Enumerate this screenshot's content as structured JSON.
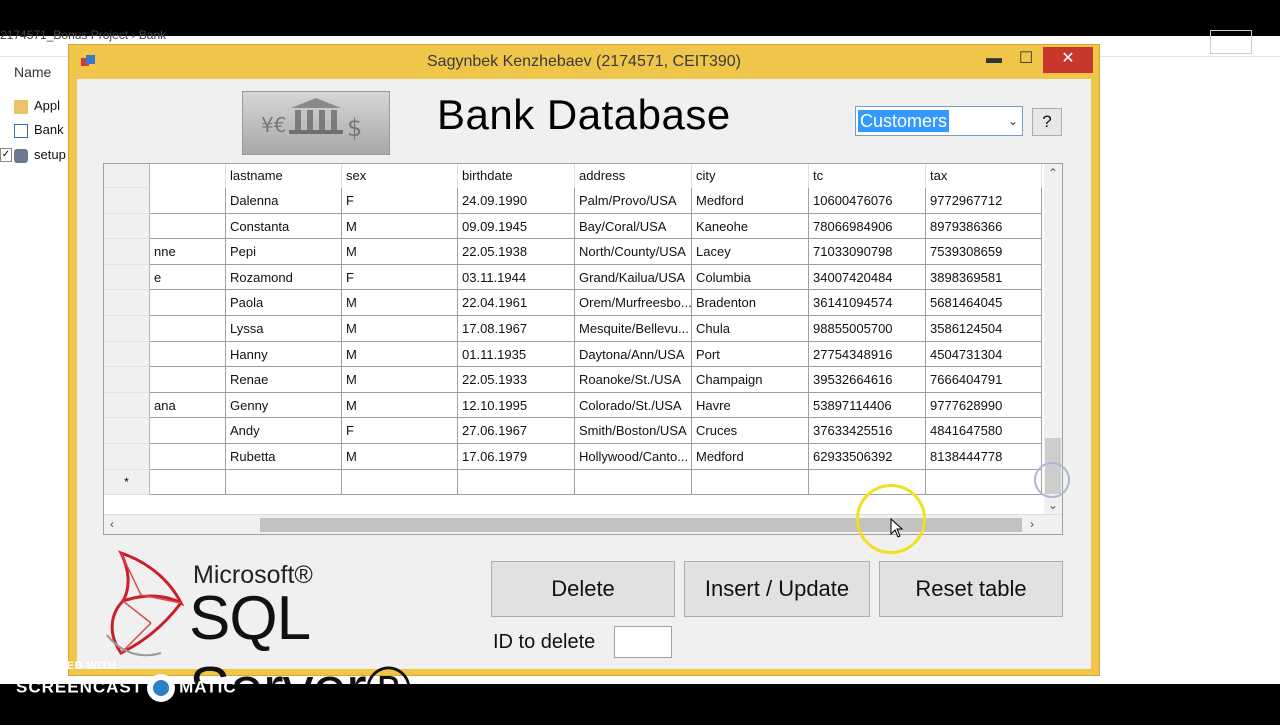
{
  "explorer": {
    "path_text": "2174571_Bonus Project  ›  Bank",
    "column_header": "Name",
    "items": [
      "Appl",
      "Bank",
      "setup"
    ]
  },
  "window": {
    "title": "Sagynbek Kenzhebaev (2174571, CEIT390)",
    "minimize": "▬",
    "maximize": "☐",
    "close": "✕"
  },
  "app": {
    "title": "Bank Database",
    "table_select": "Customers",
    "help_label": "?"
  },
  "grid": {
    "columns": [
      "",
      "lastname",
      "sex",
      "birthdate",
      "address",
      "city",
      "tc",
      "tax"
    ],
    "rows": [
      [
        "",
        "Dalenna",
        "F",
        "24.09.1990",
        "Palm/Provo/USA",
        "Medford",
        "10600476076",
        "9772967712"
      ],
      [
        "",
        "Constanta",
        "M",
        "09.09.1945",
        "Bay/Coral/USA",
        "Kaneohe",
        "78066984906",
        "8979386366"
      ],
      [
        "nne",
        "Pepi",
        "M",
        "22.05.1938",
        "North/County/USA",
        "Lacey",
        "71033090798",
        "7539308659"
      ],
      [
        "e",
        "Rozamond",
        "F",
        "03.11.1944",
        "Grand/Kailua/USA",
        "Columbia",
        "34007420484",
        "3898369581"
      ],
      [
        "",
        "Paola",
        "M",
        "22.04.1961",
        "Orem/Murfreesbo...",
        "Bradenton",
        "36141094574",
        "5681464045"
      ],
      [
        "",
        "Lyssa",
        "M",
        "17.08.1967",
        "Mesquite/Bellevu...",
        "Chula",
        "98855005700",
        "3586124504"
      ],
      [
        "",
        "Hanny",
        "M",
        "01.11.1935",
        "Daytona/Ann/USA",
        "Port",
        "27754348916",
        "4504731304"
      ],
      [
        "",
        "Renae",
        "M",
        "22.05.1933",
        "Roanoke/St./USA",
        "Champaign",
        "39532664616",
        "7666404791"
      ],
      [
        "ana",
        "Genny",
        "M",
        "12.10.1995",
        "Colorado/St./USA",
        "Havre",
        "53897114406",
        "9777628990"
      ],
      [
        "",
        "Andy",
        "F",
        "27.06.1967",
        "Smith/Boston/USA",
        "Cruces",
        "37633425516",
        "4841647580"
      ],
      [
        "",
        "Rubetta",
        "M",
        "17.06.1979",
        "Hollywood/Canto...",
        "Medford",
        "62933506392",
        "8138444778"
      ]
    ],
    "new_row_marker": "*"
  },
  "buttons": {
    "delete": "Delete",
    "insert_update": "Insert / Update",
    "reset": "Reset table"
  },
  "delete_form": {
    "label": "ID to delete",
    "value": ""
  },
  "logo": {
    "microsoft": "Microsoft®",
    "product": "SQL Server®"
  },
  "watermark": {
    "line1": "RECORDED WITH",
    "left": "SCREENCAST",
    "right": "MATIC"
  },
  "colors": {
    "window_frame": "#f0c64a",
    "close_button": "#c7362b",
    "selection": "#3399ff"
  }
}
